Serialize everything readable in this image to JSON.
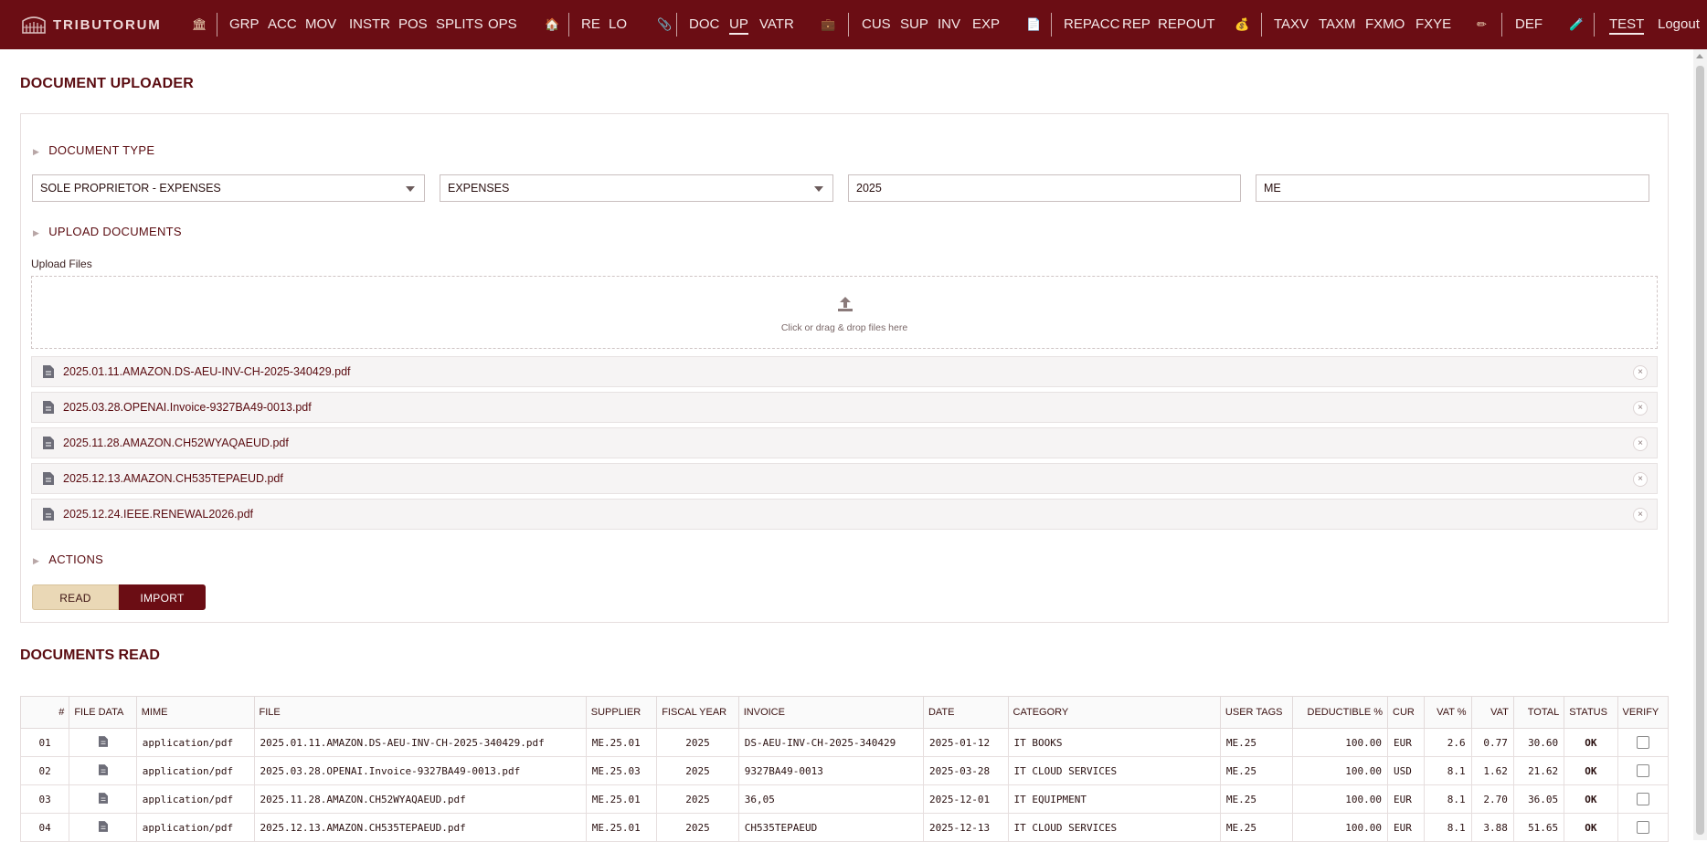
{
  "app": {
    "brand": "TRIBUTORUM"
  },
  "nav": {
    "items": [
      "GRP",
      "ACC",
      "MOV",
      "INSTR",
      "POS",
      "SPLITS",
      "OPS",
      "RE",
      "LO",
      "DOC",
      "UP",
      "VATR",
      "CUS",
      "SUP",
      "INV",
      "EXP",
      "REPACC",
      "REP",
      "REPOUT",
      "TAXV",
      "TAXM",
      "FXMO",
      "FXYE",
      "DEF",
      "TEST",
      "Logout"
    ],
    "active": [
      "UP",
      "TEST"
    ],
    "icons": [
      "bank-icon",
      "home-icon",
      "paperclip-icon",
      "briefcase-icon",
      "document-icon",
      "money-bag-icon",
      "pencil-icon",
      "test-tube-icon"
    ]
  },
  "page": {
    "title": "DOCUMENT UPLOADER"
  },
  "doc_type": {
    "heading": "DOCUMENT TYPE",
    "entity": "SOLE PROPRIETOR - EXPENSES",
    "kind": "EXPENSES",
    "year": "2025",
    "code": "ME"
  },
  "upload": {
    "heading": "UPLOAD DOCUMENTS",
    "label": "Upload Files",
    "dropzone_text": "Click or drag & drop files here",
    "files": [
      "2025.01.11.AMAZON.DS-AEU-INV-CH-2025-340429.pdf",
      "2025.03.28.OPENAI.Invoice-9327BA49-0013.pdf",
      "2025.11.28.AMAZON.CH52WYAQAEUD.pdf",
      "2025.12.13.AMAZON.CH535TEPAEUD.pdf",
      "2025.12.24.IEEE.RENEWAL2026.pdf"
    ],
    "remove_glyph": "×"
  },
  "actions": {
    "heading": "ACTIONS",
    "read": "READ",
    "import": "IMPORT"
  },
  "docs_read": {
    "title": "DOCUMENTS READ",
    "columns": [
      "#",
      "FILE DATA",
      "MIME",
      "FILE",
      "SUPPLIER",
      "FISCAL YEAR",
      "INVOICE",
      "DATE",
      "CATEGORY",
      "USER TAGS",
      "DEDUCTIBLE %",
      "CUR",
      "VAT %",
      "VAT",
      "TOTAL",
      "STATUS",
      "VERIFY"
    ],
    "rows": [
      {
        "n": "01",
        "mime": "application/pdf",
        "file": "2025.01.11.AMAZON.DS-AEU-INV-CH-2025-340429.pdf",
        "supplier": "ME.25.01",
        "fy": "2025",
        "invoice": "DS-AEU-INV-CH-2025-340429",
        "date": "2025-01-12",
        "category": "IT BOOKS",
        "tags": "ME.25",
        "deductible": "100.00",
        "cur": "EUR",
        "vat_pct": "2.6",
        "vat": "0.77",
        "total": "30.60",
        "status": "OK"
      },
      {
        "n": "02",
        "mime": "application/pdf",
        "file": "2025.03.28.OPENAI.Invoice-9327BA49-0013.pdf",
        "supplier": "ME.25.03",
        "fy": "2025",
        "invoice": "9327BA49-0013",
        "date": "2025-03-28",
        "category": "IT CLOUD SERVICES",
        "tags": "ME.25",
        "deductible": "100.00",
        "cur": "USD",
        "vat_pct": "8.1",
        "vat": "1.62",
        "total": "21.62",
        "status": "OK"
      },
      {
        "n": "03",
        "mime": "application/pdf",
        "file": "2025.11.28.AMAZON.CH52WYAQAEUD.pdf",
        "supplier": "ME.25.01",
        "fy": "2025",
        "invoice": "36,05",
        "date": "2025-12-01",
        "category": "IT EQUIPMENT",
        "tags": "ME.25",
        "deductible": "100.00",
        "cur": "EUR",
        "vat_pct": "8.1",
        "vat": "2.70",
        "total": "36.05",
        "status": "OK"
      },
      {
        "n": "04",
        "mime": "application/pdf",
        "file": "2025.12.13.AMAZON.CH535TEPAEUD.pdf",
        "supplier": "ME.25.01",
        "fy": "2025",
        "invoice": "CH535TEPAEUD",
        "date": "2025-12-13",
        "category": "IT CLOUD SERVICES",
        "tags": "ME.25",
        "deductible": "100.00",
        "cur": "EUR",
        "vat_pct": "8.1",
        "vat": "3.88",
        "total": "51.65",
        "status": "OK"
      }
    ]
  },
  "colors": {
    "brand": "#6b0d14",
    "accent": "#ead8b6",
    "ok": "#23864a"
  }
}
